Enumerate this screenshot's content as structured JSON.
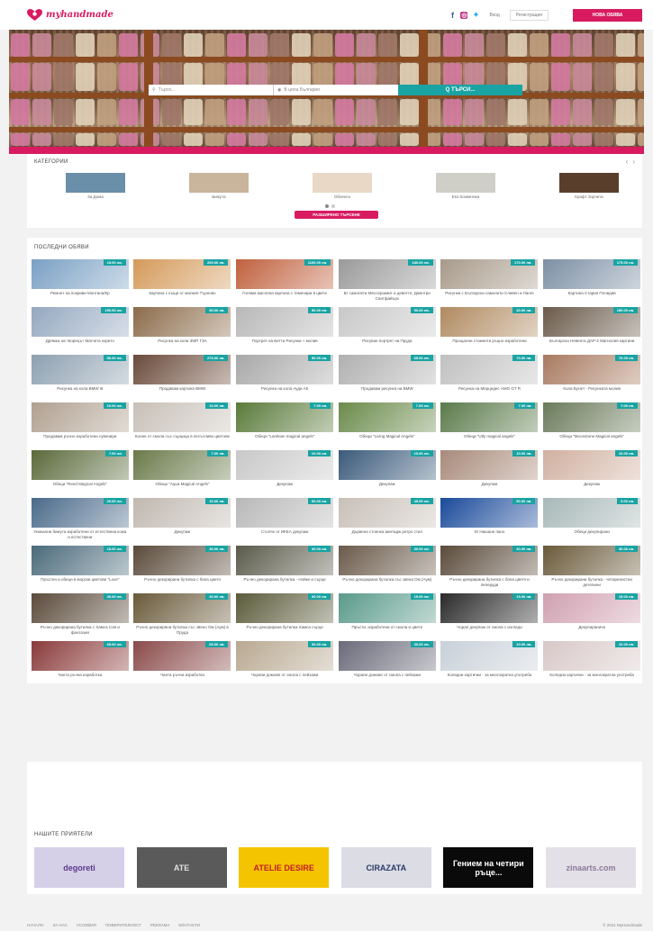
{
  "header": {
    "logo_text": "myhandmade",
    "social": [
      "facebook-icon",
      "instagram-icon",
      "twitter-icon"
    ],
    "login": "Вход",
    "register": "Регистрация",
    "new_ad": "НОВА ОБЯВА"
  },
  "search": {
    "query_placeholder": "Търся...",
    "location_placeholder": "В цяла България",
    "button": "Q ТЪРСИ..."
  },
  "categories": {
    "title": "КАТЕГОРИИ",
    "items": [
      {
        "label": "За Дома",
        "color": "#6a8fa8"
      },
      {
        "label": "Бижута",
        "color": "#c9b59b"
      },
      {
        "label": "Облекло",
        "color": "#e9d8c6"
      },
      {
        "label": "Екo Козметика",
        "color": "#cfcfc8"
      },
      {
        "label": "Крафт Зорчета",
        "color": "#5a3e2c"
      }
    ],
    "advanced_button": "РАЗШИРЕНО ТЪРСЕНЕ"
  },
  "listings": {
    "title": "ПОСЛЕДНИ ОБЯВИ",
    "items": [
      {
        "price": "15.00 лв.",
        "title": "Ремонт на покриви Монтана/Кр",
        "color": "#7aa0c4"
      },
      {
        "price": "200.00 лв.",
        "title": "Картина с къщи от малкия Търново",
        "color": "#d49a5a"
      },
      {
        "price": "1100.00 лв.",
        "title": "Голяма маслена картина с теменари в цвете",
        "color": "#c0603d"
      },
      {
        "price": "180.00 лв.",
        "title": "Бг самолети Мессершмит и деветте, Джентри Спитфайърх",
        "color": "#9a9a9a"
      },
      {
        "price": "170.00 лв.",
        "title": "Рисунка с Български самолети Сливен и Ланге",
        "color": "#a89a8a"
      },
      {
        "price": "175.00 лв.",
        "title": "Картина Стария Пловдив",
        "color": "#7c8fa4"
      },
      {
        "price": "150.00 лв.",
        "title": "Дрямка на творецът Магчета корито",
        "color": "#95a8c0"
      },
      {
        "price": "50.00 лв.",
        "title": "Рисунка на коли ЗМП ГЗА",
        "color": "#8b6b4a"
      },
      {
        "price": "50.00 лв.",
        "title": "Портрет на Бетти Рисунки + молив",
        "color": "#b8b8b8"
      },
      {
        "price": "50.00 лв.",
        "title": "Рисуван портрет на Пруда",
        "color": "#c8c8c8"
      },
      {
        "price": "40.00 лв.",
        "title": "Прощални стоменти ръцно изработени",
        "color": "#b08a60"
      },
      {
        "price": "150.00 лв.",
        "title": "Българска Невента ДАР-2 Магнолия картини",
        "color": "#6a5a4a"
      },
      {
        "price": "50.00 лв.",
        "title": "Рисунка на кола BMW i8",
        "color": "#8da0b0"
      },
      {
        "price": "270.00 лв.",
        "title": "Продавам картина BMW",
        "color": "#6a4a3a"
      },
      {
        "price": "50.00 лв.",
        "title": "Рисунка на кола Ауди А5",
        "color": "#a8a8a8"
      },
      {
        "price": "65.00 лв.",
        "title": "Продавам рисунка на BMW",
        "color": "#b0b0b0"
      },
      {
        "price": "70.00 лв.",
        "title": "Рисунка на Мерцедес AMG GT R",
        "color": "#c0c0c0"
      },
      {
        "price": "70.00 лв.",
        "title": "Кола Бугат! - Рисунката молив",
        "color": "#a87a60"
      },
      {
        "price": "10.00 лв.",
        "title": "Продавам ръчно изработени сувенири",
        "color": "#b0a090"
      },
      {
        "price": "10.00 лв.",
        "title": "Колие от смола със сърцица в песъчливо цветове",
        "color": "#c8c0b8"
      },
      {
        "price": "7.00 лв.",
        "title": "Обеци \"Lamkian magical angels\"",
        "color": "#5a7a3a"
      },
      {
        "price": "7.00 лв.",
        "title": "Обеци \"Living Magical Angels\"",
        "color": "#6a8a4a"
      },
      {
        "price": "7.00 лв.",
        "title": "Обеци \"Utly magical angels\"",
        "color": "#5a7a4a"
      },
      {
        "price": "7.00 лв.",
        "title": "Обеци \"Moonstone Magical angels\"",
        "color": "#6a7a5a"
      },
      {
        "price": "7.00 лв.",
        "title": "Обеци \"Reed Magical Angels\"",
        "color": "#5a6a3a"
      },
      {
        "price": "7.00 лв.",
        "title": "Обеци \"Aqua Magical Angels\"",
        "color": "#6a7a4a"
      },
      {
        "price": "10.00 лв.",
        "title": "Декупаж",
        "color": "#c8c8c8"
      },
      {
        "price": "10.00 лв.",
        "title": "Декупаж",
        "color": "#3a5a7a"
      },
      {
        "price": "10.00 лв.",
        "title": "Декупаж",
        "color": "#a88a7a"
      },
      {
        "price": "10.00 лв.",
        "title": "Декупаж",
        "color": "#d0b0a0"
      },
      {
        "price": "20.00 лв.",
        "title": "Уникални бижута изработени от естествена кожа и естествени",
        "color": "#4a6a8a"
      },
      {
        "price": "10.00 лв.",
        "title": "Декупаж",
        "color": "#c0b8b0"
      },
      {
        "price": "60.00 лв.",
        "title": "Столче от ИКЕА декупаж",
        "color": "#b8b8b8"
      },
      {
        "price": "45.00 лв.",
        "title": "Дървена стоенка винтидж ретро стил",
        "color": "#c8c0b8"
      },
      {
        "price": "50.00 лв.",
        "title": "Ю Нишане пано",
        "color": "#1a4a9a"
      },
      {
        "price": "5.00 лв.",
        "title": "Обеци декупирани",
        "color": "#a8b8b8"
      },
      {
        "price": "15.00 лв.",
        "title": "Пръстен и обеци в морски цветове \"Love\"",
        "color": "#4a6a7a"
      },
      {
        "price": "30.00 лв.",
        "title": "Ръчно декорирана бутилка с бяла цветя",
        "color": "#5a4a3a"
      },
      {
        "price": "30.00 лв.",
        "title": "Ръчно декорирана бутилка - Нойке и сърце",
        "color": "#5a5a4a"
      },
      {
        "price": "30.00 лв.",
        "title": "Ръчно декорирана бутилка със звена Ом (Аум)",
        "color": "#6a5a4a"
      },
      {
        "price": "30.00 лв.",
        "title": "Ръчно декорирана бутилка с бяла цветя и пеперуди",
        "color": "#5a4a3a"
      },
      {
        "price": "30.00 лв.",
        "title": "Ръчно декорирана бутилка - четирилистни детелини",
        "color": "#6a5a3a"
      },
      {
        "price": "30.00 лв.",
        "title": "Ръчно декорирана бутилка с Хамса Сая и фантазия",
        "color": "#5a4a3a"
      },
      {
        "price": "30.00 лв.",
        "title": "Ръчно декорирана бутилка със звено Ом (Аум) в Пруда",
        "color": "#6a5a3a"
      },
      {
        "price": "30.00 лв.",
        "title": "Ръчно декорирана бутилка Хамса сърце",
        "color": "#5a5a3a"
      },
      {
        "price": "15.00 лв.",
        "title": "Пръсти, изработени от смола и цвете",
        "color": "#5a9a8a"
      },
      {
        "price": "15.00 лв.",
        "title": "Чорап декупаж от смола с изгледи",
        "color": "#2a2a2a"
      },
      {
        "price": "15.00 лв.",
        "title": "Декупираничи",
        "color": "#d0a0b0"
      },
      {
        "price": "65.00 лв.",
        "title": "Чанта ръчна изработка",
        "color": "#8a3a3a"
      },
      {
        "price": "65.00 лв.",
        "title": "Чанта ръчна изработка",
        "color": "#8a4a4a"
      },
      {
        "price": "30.00 лв.",
        "title": "Чорапи домове от смола с пейзажи",
        "color": "#b8a890"
      },
      {
        "price": "30.00 лв.",
        "title": "Чорапи домове от смола с пейзажи",
        "color": "#6a6a7a"
      },
      {
        "price": "10.00 лв.",
        "title": "Коледни картички - за многократна употреба",
        "color": "#c8d0d8"
      },
      {
        "price": "10.00 лв.",
        "title": "Коледни картички - за многократна употреба",
        "color": "#d8c8c8"
      }
    ]
  },
  "friends": {
    "title": "НАШИТЕ ПРИЯТЕЛИ",
    "items": [
      {
        "label": "degoreti",
        "color": "#d6cfe8",
        "text_color": "#5a3a8a"
      },
      {
        "label": "ATE",
        "color": "#5a5a5a",
        "text_color": "#e0e0e0"
      },
      {
        "label": "ATELIE DESIRE",
        "color": "#f5c400",
        "text_color": "#c0202a"
      },
      {
        "label": "CIRAZATA",
        "color": "#dcdce4",
        "text_color": "#2a3a6a"
      },
      {
        "label": "Гением на четири ръце...",
        "color": "#0a0a0a",
        "text_color": "#ffffff"
      },
      {
        "label": "zinaarts.com",
        "color": "#e4e0e8",
        "text_color": "#8a7a9a"
      }
    ]
  },
  "footer": {
    "links": [
      "НАЧАЛО",
      "ЗА НАС",
      "УСЛОВИЯ",
      "ПОВЕРИТЕЛНОСТ",
      "РЕКЛАМА",
      "КОНТАКТИ"
    ],
    "copyright": "© 2021 MyHandmade"
  }
}
